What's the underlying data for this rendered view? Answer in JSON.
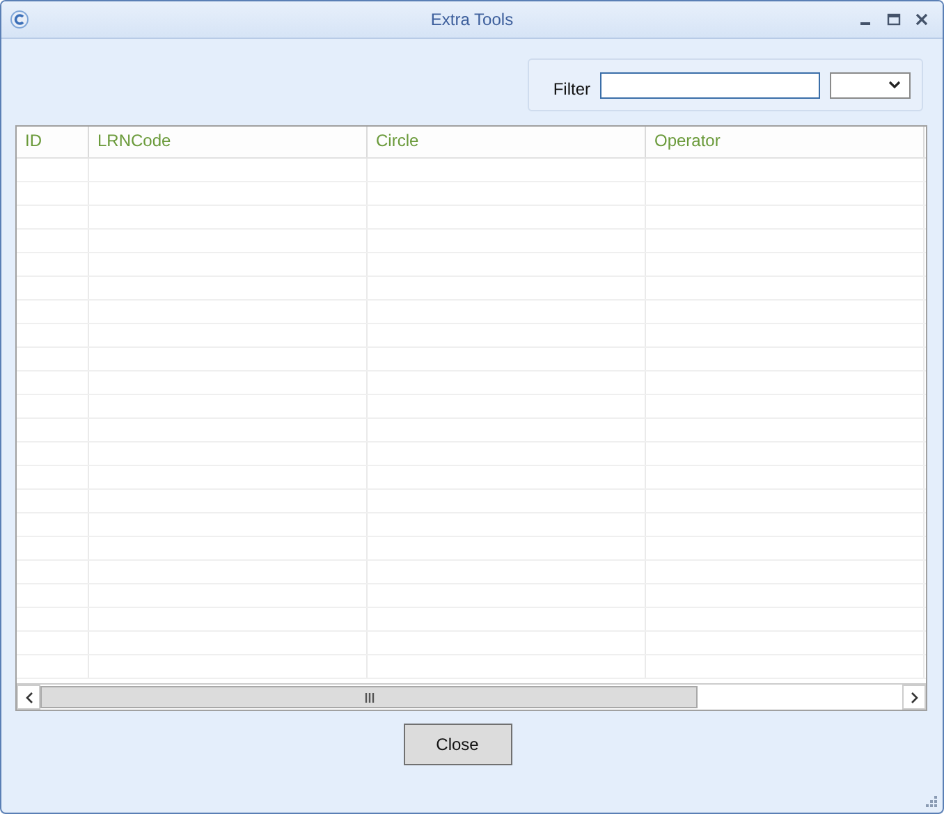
{
  "window": {
    "title": "Extra Tools"
  },
  "filter": {
    "label": "Filter"
  },
  "table": {
    "columns": [
      "ID",
      "LRNCode",
      "Circle",
      "Operator"
    ]
  },
  "buttons": [
    "Close"
  ]
}
